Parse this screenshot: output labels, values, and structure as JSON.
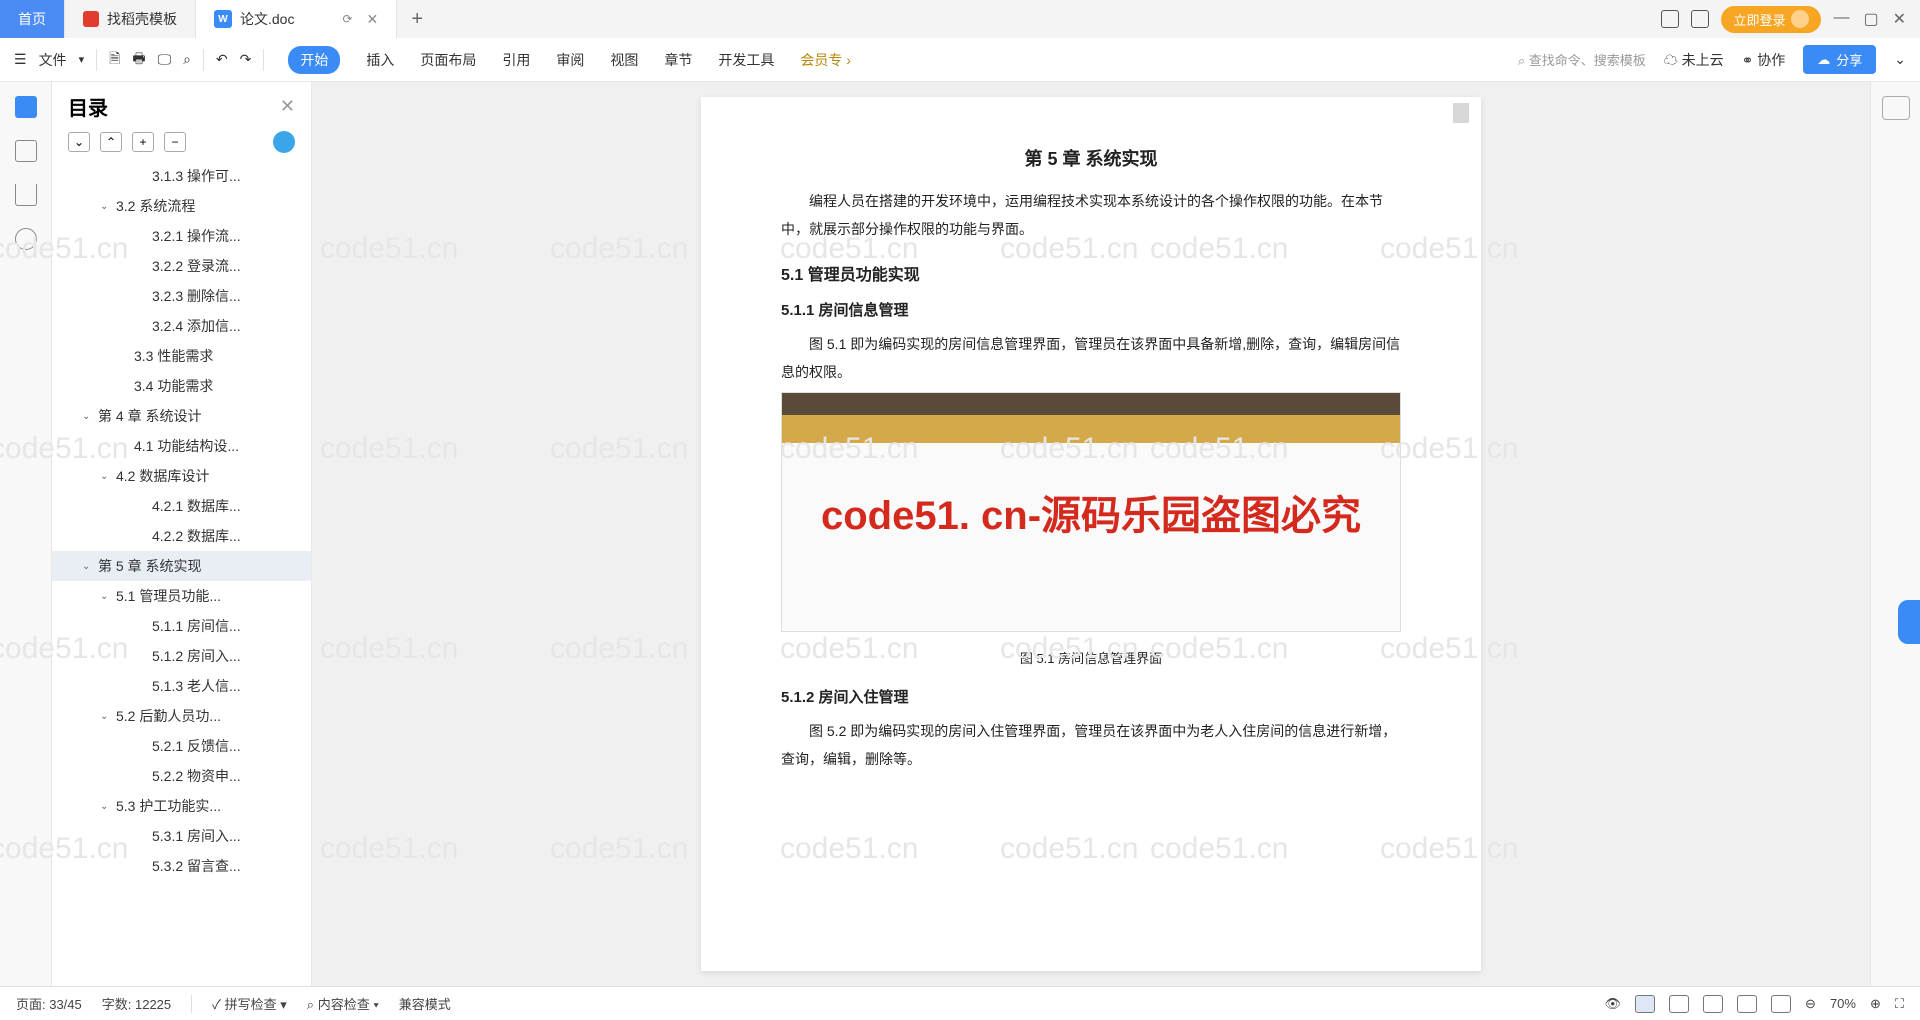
{
  "tabs": {
    "home": "首页",
    "template": "找稻壳模板",
    "doc": "论文.doc"
  },
  "login": "立即登录",
  "toolbar": {
    "file": "文件",
    "menu": [
      "开始",
      "插入",
      "页面布局",
      "引用",
      "审阅",
      "视图",
      "章节",
      "开发工具",
      "会员专"
    ],
    "search": "查找命令、搜索模板",
    "cloud": "未上云",
    "collab": "协作",
    "share": "分享"
  },
  "outline": {
    "title": "目录",
    "items": [
      {
        "t": "3.1.3 操作可...",
        "d": 4
      },
      {
        "t": "3.2 系统流程",
        "d": 2,
        "c": true
      },
      {
        "t": "3.2.1 操作流...",
        "d": 4
      },
      {
        "t": "3.2.2 登录流...",
        "d": 4
      },
      {
        "t": "3.2.3 删除信...",
        "d": 4
      },
      {
        "t": "3.2.4 添加信...",
        "d": 4
      },
      {
        "t": "3.3 性能需求",
        "d": 3
      },
      {
        "t": "3.4 功能需求",
        "d": 3
      },
      {
        "t": "第 4 章  系统设计",
        "d": 1,
        "c": true
      },
      {
        "t": "4.1 功能结构设...",
        "d": 3
      },
      {
        "t": "4.2 数据库设计",
        "d": 2,
        "c": true
      },
      {
        "t": "4.2.1 数据库...",
        "d": 4
      },
      {
        "t": "4.2.2 数据库...",
        "d": 4
      },
      {
        "t": "第 5 章  系统实现",
        "d": 1,
        "c": true,
        "sel": true
      },
      {
        "t": "5.1 管理员功能...",
        "d": 2,
        "c": true
      },
      {
        "t": "5.1.1 房间信...",
        "d": 4
      },
      {
        "t": "5.1.2 房间入...",
        "d": 4
      },
      {
        "t": "5.1.3 老人信...",
        "d": 4
      },
      {
        "t": "5.2 后勤人员功...",
        "d": 2,
        "c": true
      },
      {
        "t": "5.2.1 反馈信...",
        "d": 4
      },
      {
        "t": "5.2.2 物资申...",
        "d": 4
      },
      {
        "t": "5.3 护工功能实...",
        "d": 2,
        "c": true
      },
      {
        "t": "5.3.1 房间入...",
        "d": 4
      },
      {
        "t": "5.3.2 留言查...",
        "d": 4
      }
    ]
  },
  "doc": {
    "h1": "第 5 章  系统实现",
    "p1": "编程人员在搭建的开发环境中，运用编程技术实现本系统设计的各个操作权限的功能。在本节中，就展示部分操作权限的功能与界面。",
    "h2": "5.1  管理员功能实现",
    "h3a": "5.1.1  房间信息管理",
    "p2": "图 5.1 即为编码实现的房间信息管理界面，管理员在该界面中具备新增,删除，查询，编辑房间信息的权限。",
    "cap1": "图 5.1 房间信息管理界面",
    "h3b": "5.1.2  房间入住管理",
    "p3": "图 5.2 即为编码实现的房间入住管理界面，管理员在该界面中为老人入住房间的信息进行新增，查询，编辑，删除等。"
  },
  "watermark": "code51. cn-源码乐园盗图必究",
  "wm_text": "code51.cn",
  "status": {
    "page": "页面: 33/45",
    "words": "字数: 12225",
    "spell": "拼写检查",
    "content": "内容检查",
    "compat": "兼容模式",
    "zoom": "70%"
  }
}
